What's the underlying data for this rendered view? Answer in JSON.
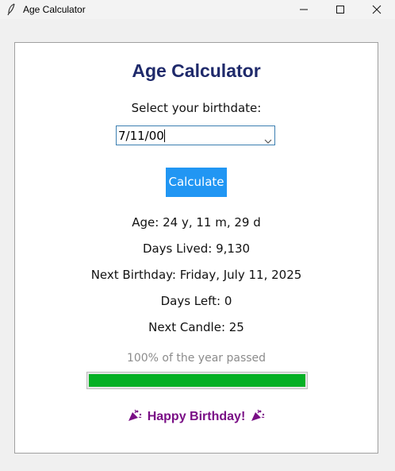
{
  "window": {
    "title": "Age Calculator",
    "icon": "feather-icon"
  },
  "main": {
    "heading": "Age Calculator",
    "prompt": "Select your birthdate:",
    "birthdate_value": "7/11/00",
    "calculate_label": "Calculate",
    "results": {
      "age": "Age: 24 y, 11 m, 29 d",
      "days_lived": "Days Lived: 9,130",
      "next_birthday": "Next Birthday: Friday, July 11, 2025",
      "days_left": "Days Left: 0",
      "next_candle": "Next Candle: 25"
    },
    "progress_label": "100% of the year passed",
    "progress_fraction": 1.0,
    "birthday_message": "Happy Birthday!",
    "birthday_icon": "party-popper-icon"
  },
  "colors": {
    "heading": "#1f2a6b",
    "button": "#2196f3",
    "progress_fill": "#06b025",
    "birthday_message": "#7a0f86"
  }
}
